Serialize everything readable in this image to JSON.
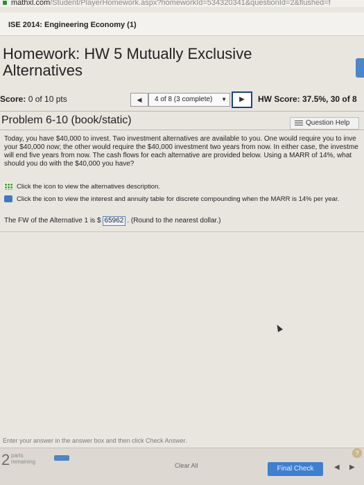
{
  "browser": {
    "url_domain": "mathxl.com",
    "url_path": "/Student/PlayerHomework.aspx?homeworkId=534320341&questionId=2&flushed=f"
  },
  "course": {
    "name": "ISE 2014: Engineering Economy (1)"
  },
  "homework": {
    "title": "Homework: HW 5 Mutually Exclusive Alternatives"
  },
  "score": {
    "label": "Score:",
    "value": "0 of 10 pts",
    "question_selector": "4 of 8 (3 complete)",
    "hw_score": "HW Score: 37.5%, 30 of 8"
  },
  "problem": {
    "title": "Problem 6-10 (book/static)",
    "help_label": "Question Help",
    "text": "Today, you have $40,000 to invest. Two investment alternatives are available to you. One would require you to inve your $40,000 now; the other would require the $40,000 investment two years from now. In either case, the investme will end five years from now. The cash flows for each alternative are provided below. Using a MARR of 14%, what should you do with the $40,000 you have?",
    "links": [
      {
        "text": "Click the icon to view the alternatives description.",
        "icon": "grid-icon"
      },
      {
        "text": "Click the icon to view the interest and annuity table for discrete compounding when the MARR is 14% per year.",
        "icon": "table-icon"
      }
    ],
    "answer_prefix": "The FW of the Alternative 1 is $",
    "answer_value": "65962",
    "answer_suffix": ". (Round to the nearest dollar.)"
  },
  "footer": {
    "instructions": "Enter your answer in the answer box and then click Check Answer.",
    "parts_count": "2",
    "parts_label_1": "parts",
    "parts_label_2": "remaining",
    "clear_label": "Clear All",
    "final_label": "Final Check",
    "help_glyph": "?"
  },
  "colors": {
    "accent": "#3f7fd0",
    "nav_border": "#1e3f8e"
  }
}
